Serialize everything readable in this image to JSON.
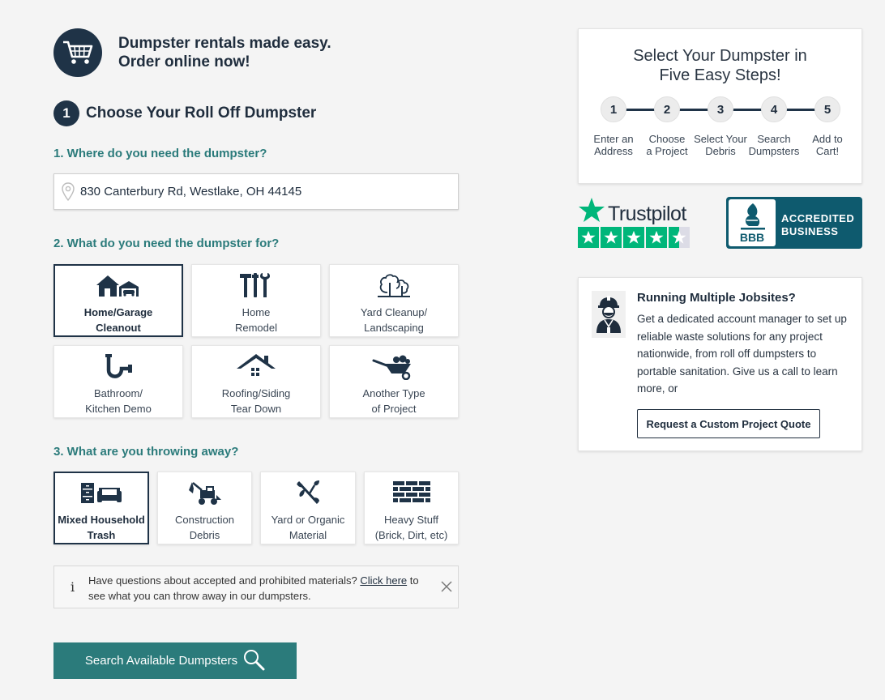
{
  "hero": {
    "line1": "Dumpster rentals made easy.",
    "line2": "Order online now!",
    "icon": "shopping-cart-icon"
  },
  "step": {
    "number": "1",
    "title": "Choose Your Roll Off Dumpster"
  },
  "questions": {
    "where": "1. Where do you need the dumpster?",
    "what_for": "2. What do you need the dumpster for?",
    "throwing": "3. What are you throwing away?"
  },
  "address": {
    "value": "830 Canterbury Rd, Westlake, OH 44145",
    "icon": "location-pin-icon"
  },
  "projects": [
    {
      "label": "Home/Garage\nCleanout",
      "icon": "house-garage-icon",
      "selected": true
    },
    {
      "label": "Home\nRemodel",
      "icon": "tools-icon",
      "selected": false
    },
    {
      "label": "Yard Cleanup/\nLandscaping",
      "icon": "trees-icon",
      "selected": false
    },
    {
      "label": "Bathroom/\nKitchen Demo",
      "icon": "pipe-icon",
      "selected": false
    },
    {
      "label": "Roofing/Siding\nTear Down",
      "icon": "roof-icon",
      "selected": false
    },
    {
      "label": "Another Type\nof Project",
      "icon": "wheelbarrow-icon",
      "selected": false
    }
  ],
  "debris": [
    {
      "label": "Mixed Household\nTrash",
      "icon": "furniture-icon",
      "selected": true
    },
    {
      "label": "Construction\nDebris",
      "icon": "excavator-icon",
      "selected": false
    },
    {
      "label": "Yard or Organic\nMaterial",
      "icon": "branch-icon",
      "selected": false
    },
    {
      "label": "Heavy Stuff\n(Brick, Dirt, etc)",
      "icon": "brick-wall-icon",
      "selected": false
    }
  ],
  "info": {
    "icon": "info-icon",
    "before": "Have questions about accepted and prohibited materials? ",
    "link": "Click here",
    "after": " to see what you can throw away in our dumpsters."
  },
  "search_button": {
    "label": "Search Available Dumpsters",
    "icon": "magnifier-icon"
  },
  "steps_card": {
    "title_line1": "Select Your Dumpster in",
    "title_line2": "Five Easy Steps!",
    "steps": [
      {
        "num": "1",
        "label": "Enter an\nAddress"
      },
      {
        "num": "2",
        "label": "Choose\na Project"
      },
      {
        "num": "3",
        "label": "Select Your\nDebris"
      },
      {
        "num": "4",
        "label": "Search\nDumpsters"
      },
      {
        "num": "5",
        "label": "Add to\nCart!"
      }
    ]
  },
  "trustpilot": {
    "word": "Trustpilot",
    "stars": 4.5,
    "color": "#00b67a"
  },
  "bbb": {
    "badge": "BBB",
    "text": "ACCREDITED\nBUSINESS",
    "color": "#0e5a6e"
  },
  "jobs": {
    "title": "Running Multiple Jobsites?",
    "body": "Get a dedicated account manager to set up reliable waste solutions for any project nationwide, from roll off dumpsters to portable sanitation. Give us a call to learn more, or",
    "button": "Request a Custom Project Quote",
    "icon": "construction-worker-icon"
  },
  "colors": {
    "teal": "#2b7b7b",
    "navy": "#1f3347",
    "bg": "#f4f4f4"
  }
}
